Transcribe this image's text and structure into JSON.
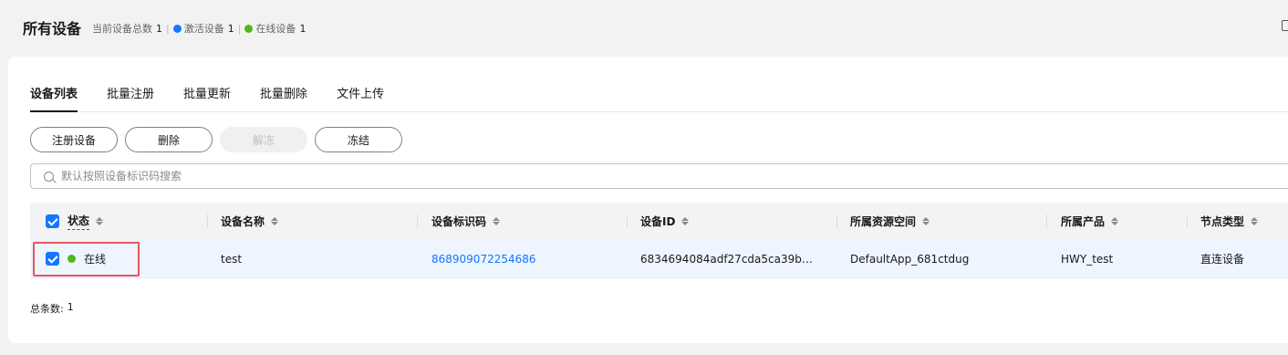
{
  "header": {
    "title": "所有设备",
    "total_label": "当前设备总数",
    "total_count": "1",
    "active_label": "激活设备",
    "active_count": "1",
    "online_label": "在线设备",
    "online_count": "1",
    "colors": {
      "active_dot": "#1476ff",
      "online_dot": "#50b91a"
    }
  },
  "tabs": [
    "设备列表",
    "批量注册",
    "批量更新",
    "批量删除",
    "文件上传"
  ],
  "buttons": {
    "register": "注册设备",
    "delete": "删除",
    "unfreeze": "解冻",
    "freeze": "冻结"
  },
  "search": {
    "placeholder": "默认按照设备标识码搜索"
  },
  "table": {
    "columns": [
      "状态",
      "设备名称",
      "设备标识码",
      "设备ID",
      "所属资源空间",
      "所属产品",
      "节点类型"
    ],
    "rows": [
      {
        "status": "在线",
        "name": "test",
        "identifier": "868909072254686",
        "device_id": "6834694084adf27cda5ca39b…",
        "resource_space": "DefaultApp_681ctdug",
        "product": "HWY_test",
        "node_type": "直连设备"
      }
    ]
  },
  "footer": {
    "total_label": "总条数:",
    "total_value": "1"
  },
  "colors": {
    "accent": "#1476ff",
    "online": "#50b91a",
    "highlight": "#e9545e"
  }
}
